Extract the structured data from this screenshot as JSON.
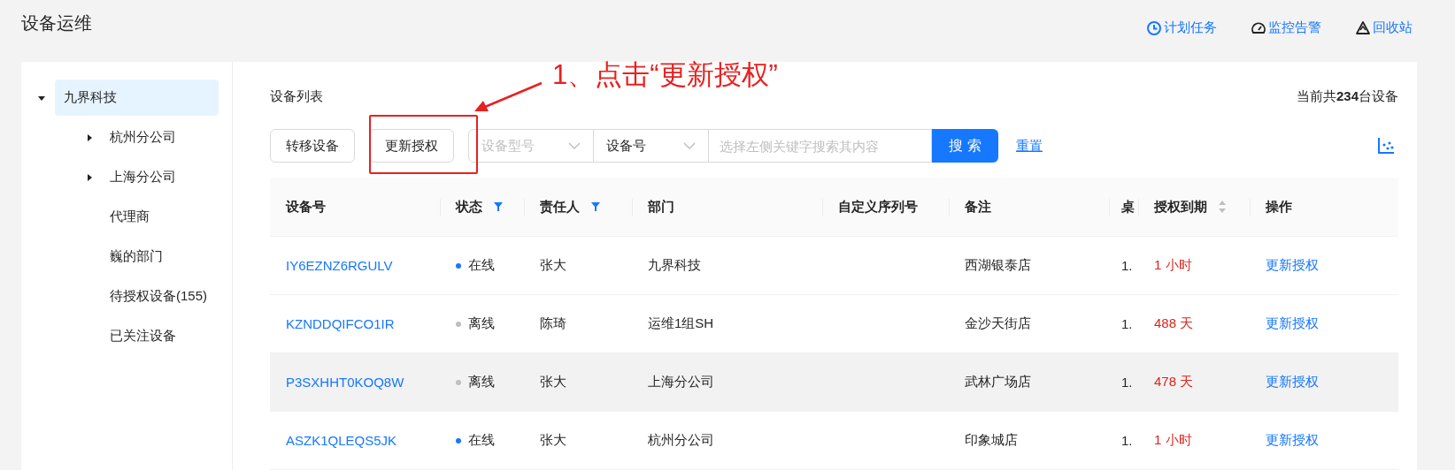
{
  "page": {
    "title": "设备运维"
  },
  "header_links": [
    {
      "label": "计划任务",
      "kind": "clock"
    },
    {
      "label": "监控告警",
      "kind": "gauge"
    },
    {
      "label": "回收站",
      "kind": "recycle"
    }
  ],
  "sidebar": {
    "items": [
      {
        "label": "九界科技",
        "selected": true,
        "kind": "branch",
        "expanded": true,
        "children": [
          {
            "label": "杭州分公司",
            "selected": false,
            "kind": "branch",
            "expanded": false
          },
          {
            "label": "上海分公司",
            "selected": false,
            "kind": "branch",
            "expanded": false
          },
          {
            "label": "代理商",
            "selected": false,
            "kind": "leaf"
          },
          {
            "label": "巍的部门",
            "selected": false,
            "kind": "leaf"
          },
          {
            "label": "待授权设备(155)",
            "selected": false,
            "kind": "leaf"
          },
          {
            "label": "已关注设备",
            "selected": false,
            "kind": "leaf"
          }
        ]
      }
    ]
  },
  "list": {
    "title": "设备列表",
    "count": "当前共**234**台设备",
    "toolbar": {
      "buttons": [
        "转移设备",
        "更新授权"
      ],
      "selects": [
        {
          "placeholder": "设备型号"
        },
        {
          "value": "设备号"
        }
      ],
      "search": {
        "placeholder": "选择左侧关键字搜索其内容"
      },
      "search_button": "搜 索",
      "reset_link": "重置"
    },
    "table": {
      "columns": [
        {
          "label": "设备号",
          "filterable": false,
          "sortable": false
        },
        {
          "label": "状态",
          "filterable": true,
          "sortable": false
        },
        {
          "label": "责任人",
          "filterable": true,
          "sortable": false
        },
        {
          "label": "部门",
          "filterable": false,
          "sortable": false
        },
        {
          "label": "自定义序列号",
          "filterable": false,
          "sortable": false
        },
        {
          "label": "备注",
          "filterable": false,
          "sortable": false
        },
        {
          "label": "桌",
          "filterable": false,
          "sortable": false
        },
        {
          "label": "授权到期",
          "filterable": false,
          "sortable": true
        },
        {
          "label": "操作",
          "filterable": false,
          "sortable": false
        }
      ],
      "rows": [
        {
          "device_id": "IY6EZNZ6RGULV",
          "status": {
            "text": "在线",
            "color": "#1677ff"
          },
          "owner": "张大",
          "department": "九界科技",
          "note": "西湖银泰店",
          "column_7": "1.",
          "expiry": "1 小时",
          "action": "更新授权",
          "hovered": false
        },
        {
          "device_id": "KZNDDQIFCO1IR",
          "status": {
            "text": "离线",
            "color": "#bfbfbf"
          },
          "owner": "陈琦",
          "department": "运维1组SH",
          "note": "金沙天街店",
          "column_7": "1.",
          "expiry": "488 天",
          "action": "更新授权",
          "hovered": false
        },
        {
          "device_id": "P3SXHHT0KOQ8W",
          "status": {
            "text": "离线",
            "color": "#bfbfbf"
          },
          "owner": "张大",
          "department": "上海分公司",
          "note": "武林广场店",
          "column_7": "1.",
          "expiry": "478 天",
          "action": "更新授权",
          "hovered": true
        },
        {
          "device_id": "ASZK1QLEQS5JK",
          "status": {
            "text": "在线",
            "color": "#1677ff"
          },
          "owner": "张大",
          "department": "杭州分公司",
          "note": "印象城店",
          "column_7": "1.",
          "expiry": "1 小时",
          "action": "更新授权",
          "hovered": false
        }
      ]
    }
  },
  "annotation": {
    "text": "1、点击“更新授权”"
  }
}
